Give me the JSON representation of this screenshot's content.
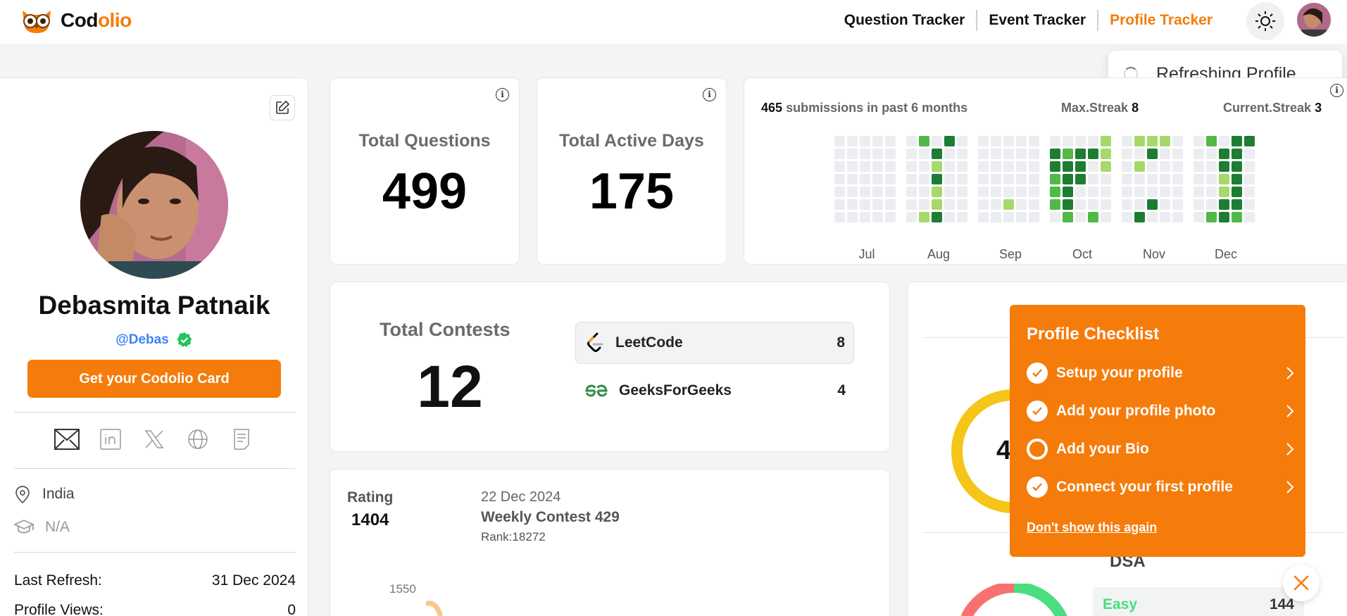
{
  "header": {
    "logo_part1": "Cod",
    "logo_part2": "olio",
    "nav": [
      "Question Tracker",
      "Event Tracker",
      "Profile Tracker"
    ]
  },
  "toast": {
    "text": "Refreshing Profile..."
  },
  "profile": {
    "name": "Debasmita Patnaik",
    "handle": "@Debas",
    "card_button": "Get your Codolio Card",
    "location": "India",
    "education": "N/A",
    "last_refresh_label": "Last Refresh:",
    "last_refresh_value": "31 Dec 2024",
    "views_label": "Profile Views:",
    "views_value": "0"
  },
  "stats": {
    "total_questions_label": "Total Questions",
    "total_questions": "499",
    "active_days_label": "Total Active Days",
    "active_days": "175"
  },
  "heatmap": {
    "submissions": "465",
    "submissions_text": "submissions in past 6 months",
    "max_streak_label": "Max.Streak",
    "max_streak": "8",
    "current_streak_label": "Current.Streak",
    "current_streak": "3",
    "months": [
      "Jul",
      "Aug",
      "Sep",
      "Oct",
      "Nov",
      "Dec"
    ]
  },
  "contests": {
    "label": "Total Contests",
    "total": "12",
    "platforms": [
      {
        "name": "LeetCode",
        "count": "8"
      },
      {
        "name": "GeeksForGeeks",
        "count": "4"
      }
    ]
  },
  "rating": {
    "label": "Rating",
    "value": "1404",
    "date": "22 Dec 2024",
    "contest": "Weekly Contest 429",
    "rank": "Rank:18272",
    "axis_tick": "1550"
  },
  "checklist": {
    "title": "Profile Checklist",
    "items": [
      {
        "label": "Setup your profile",
        "done": true
      },
      {
        "label": "Add your profile photo",
        "done": true
      },
      {
        "label": "Add your Bio",
        "done": false
      },
      {
        "label": "Connect your first profile",
        "done": true
      }
    ],
    "dismiss": "Don't show this again"
  },
  "problems": {
    "donut_partial": "4",
    "section": "DSA",
    "easy_label": "Easy",
    "easy_value": "144"
  },
  "colors": {
    "brand": "#f57c0b",
    "verified": "#22c55e",
    "handle": "#3b82f6"
  }
}
